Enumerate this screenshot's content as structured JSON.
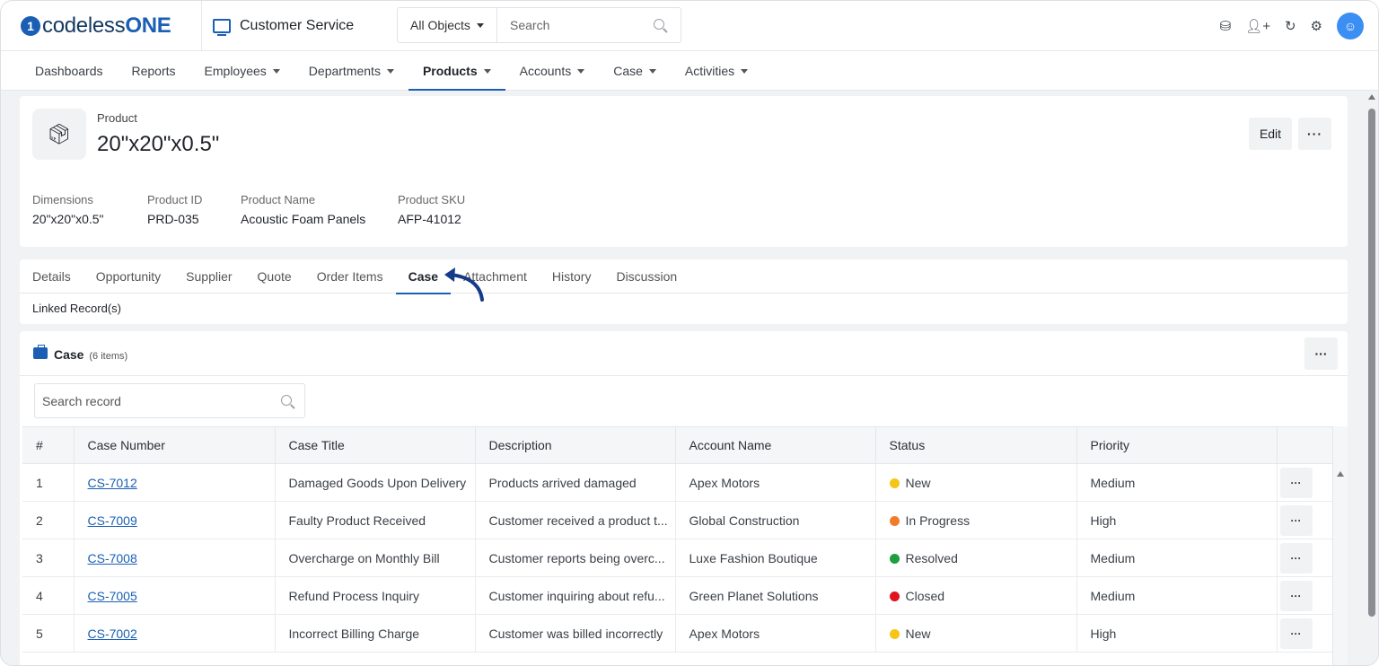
{
  "brand": {
    "logo_mark": "1",
    "logo_prefix": "codeless",
    "logo_suffix": "ONE"
  },
  "app": {
    "name": "Customer Service",
    "icon": "app-chart-icon"
  },
  "global_search": {
    "object_select": "All Objects",
    "placeholder": "Search"
  },
  "top_icons": [
    "database-icon",
    "add-user-icon",
    "history-icon",
    "gear-icon",
    "user-avatar-icon"
  ],
  "nav": [
    {
      "label": "Dashboards",
      "dropdown": false
    },
    {
      "label": "Reports",
      "dropdown": false
    },
    {
      "label": "Employees",
      "dropdown": true
    },
    {
      "label": "Departments",
      "dropdown": true
    },
    {
      "label": "Products",
      "dropdown": true,
      "active": true
    },
    {
      "label": "Accounts",
      "dropdown": true
    },
    {
      "label": "Case",
      "dropdown": true
    },
    {
      "label": "Activities",
      "dropdown": true
    }
  ],
  "product": {
    "kind": "Product",
    "title": "20\"x20\"x0.5\"",
    "edit_label": "Edit",
    "more_label": "···",
    "fields": [
      {
        "label": "Dimensions",
        "value": "20\"x20\"x0.5\""
      },
      {
        "label": "Product ID",
        "value": "PRD-035"
      },
      {
        "label": "Product Name",
        "value": "Acoustic Foam Panels"
      },
      {
        "label": "Product SKU",
        "value": "AFP-41012"
      }
    ]
  },
  "tabs": [
    "Details",
    "Opportunity",
    "Supplier",
    "Quote",
    "Order Items",
    "Case",
    "Attachment",
    "History",
    "Discussion"
  ],
  "active_tab": "Case",
  "linked_label": "Linked Record(s)",
  "case_section": {
    "title": "Case",
    "count": "(6 items)",
    "more_label": "···",
    "search_placeholder": "Search record",
    "columns": [
      "#",
      "Case Number",
      "Case Title",
      "Description",
      "Account Name",
      "Status",
      "Priority"
    ],
    "rows": [
      {
        "num": "1",
        "case_number": "CS-7012",
        "title": "Damaged Goods Upon Delivery",
        "description": "Products arrived damaged",
        "account": "Apex Motors",
        "status": "New",
        "status_color": "#f5c518",
        "priority": "Medium"
      },
      {
        "num": "2",
        "case_number": "CS-7009",
        "title": "Faulty Product Received",
        "description": "Customer received a product t...",
        "account": "Global Construction",
        "status": "In Progress",
        "status_color": "#f07c2b",
        "priority": "High"
      },
      {
        "num": "3",
        "case_number": "CS-7008",
        "title": "Overcharge on Monthly Bill",
        "description": "Customer reports being overc...",
        "account": "Luxe Fashion Boutique",
        "status": "Resolved",
        "status_color": "#1e9e3e",
        "priority": "Medium"
      },
      {
        "num": "4",
        "case_number": "CS-7005",
        "title": "Refund Process Inquiry",
        "description": "Customer inquiring about refu...",
        "account": "Green Planet Solutions",
        "status": "Closed",
        "status_color": "#e0131f",
        "priority": "Medium"
      },
      {
        "num": "5",
        "case_number": "CS-7002",
        "title": "Incorrect Billing Charge",
        "description": "Customer was billed incorrectly",
        "account": "Apex Motors",
        "status": "New",
        "status_color": "#f5c518",
        "priority": "High"
      }
    ],
    "row_action_label": "···"
  },
  "colors": {
    "accent": "#1a5fb4",
    "avatar": "#3b8ff3"
  }
}
